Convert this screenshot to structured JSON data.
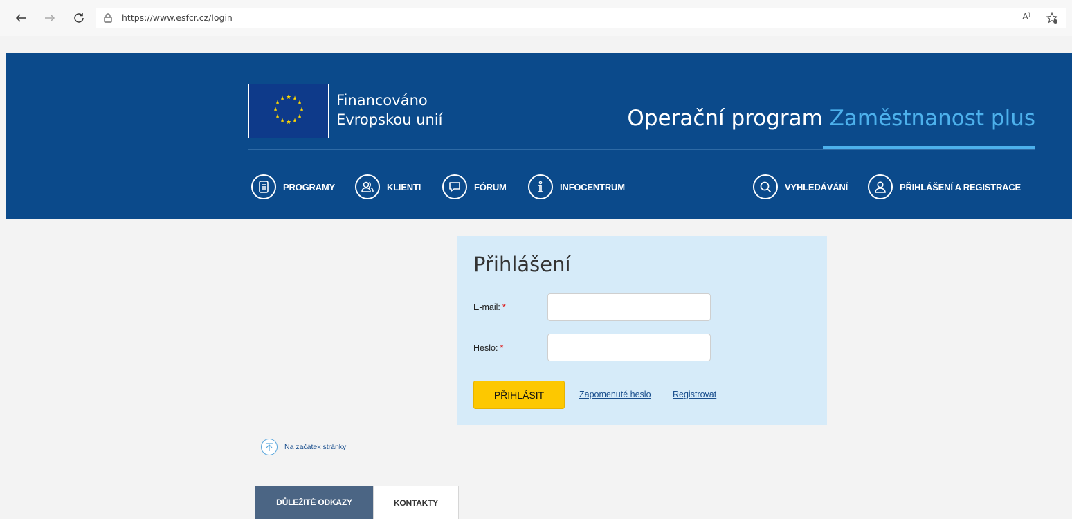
{
  "browser": {
    "url": "https://www.esfcr.cz/login",
    "read_aloud": "A⁾"
  },
  "header": {
    "eu_line1": "Financováno",
    "eu_line2": "Evropskou unií",
    "title_main": "Operační program",
    "title_highlight": "Zaměstnanost plus",
    "menu": [
      {
        "label": "PROGRAMY",
        "icon": "document-icon"
      },
      {
        "label": "KLIENTI",
        "icon": "users-icon"
      },
      {
        "label": "FÓRUM",
        "icon": "chat-icon"
      },
      {
        "label": "INFOCENTRUM",
        "icon": "info-icon"
      },
      {
        "label": "VYHLEDÁVÁNÍ",
        "icon": "search-icon"
      },
      {
        "label": "PŘIHLÁŠENÍ A REGISTRACE",
        "icon": "user-icon"
      }
    ]
  },
  "login": {
    "title": "Přihlášení",
    "email_label": "E-mail:",
    "password_label": "Heslo:",
    "required_mark": "*",
    "email_value": "",
    "password_value": "",
    "submit_label": "PŘIHLÁSIT",
    "forgot_label": "Zapomenuté heslo",
    "register_label": "Registrovat"
  },
  "back_to_top": "Na začátek stránky",
  "footer_tabs": [
    {
      "label": "DŮLEŽITÉ ODKAZY",
      "active": true
    },
    {
      "label": "KONTAKTY",
      "active": false
    }
  ],
  "colors": {
    "header_bg": "#0b4a8b",
    "accent": "#4db1ec",
    "panel_bg": "#d6ebf9",
    "button": "#fdc800"
  }
}
